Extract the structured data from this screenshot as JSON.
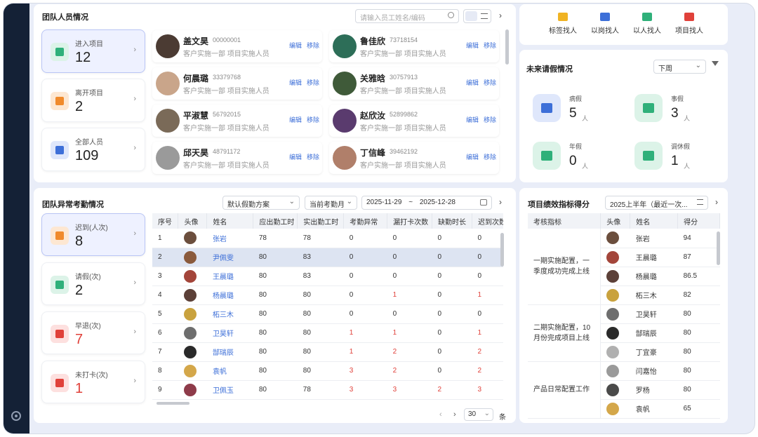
{
  "team": {
    "title": "团队人员情况",
    "search_placeholder": "请输入员工姓名/编码",
    "stats": [
      {
        "label": "进入项目",
        "value": "12",
        "color": "#2fb07a",
        "bg": "#dcf3e8"
      },
      {
        "label": "离开项目",
        "value": "2",
        "color": "#f08a2c",
        "bg": "#fde7d2"
      },
      {
        "label": "全部人员",
        "value": "109",
        "color": "#3d6fd8",
        "bg": "#dfe7fb"
      }
    ],
    "edit_label": "编辑",
    "remove_label": "移除",
    "people": [
      {
        "name": "盖文昊",
        "id": "00000001",
        "dept": "客户实施一部  项目实施人员",
        "avatar": "#4b3b33"
      },
      {
        "name": "鲁佳欣",
        "id": "73718154",
        "dept": "客户实施一部  项目实施人员",
        "avatar": "#2d6e58"
      },
      {
        "name": "何晨璐",
        "id": "33379768",
        "dept": "客户实施一部  项目实施人员",
        "avatar": "#c9a58a"
      },
      {
        "name": "关雅晗",
        "id": "30757913",
        "dept": "客户实施一部  项目实施人员",
        "avatar": "#3f5a39"
      },
      {
        "name": "平淑慧",
        "id": "56792015",
        "dept": "客户实施一部  项目实施人员",
        "avatar": "#7a6a58"
      },
      {
        "name": "赵欣汝",
        "id": "52899862",
        "dept": "客户实施一部  项目实施人员",
        "avatar": "#5a3b6e"
      },
      {
        "name": "邱天昊",
        "id": "48791172",
        "dept": "客户实施一部  项目实施人员",
        "avatar": "#9a9a9a"
      },
      {
        "name": "丁信峰",
        "id": "39462192",
        "dept": "客户实施一部  项目实施人员",
        "avatar": "#b07f6a"
      }
    ]
  },
  "finder": {
    "items": [
      {
        "label": "标签找人",
        "color": "#f0b323"
      },
      {
        "label": "以岗找人",
        "color": "#3d6fd8"
      },
      {
        "label": "以人找人",
        "color": "#2fb07a"
      },
      {
        "label": "项目找人",
        "color": "#e0413a"
      }
    ]
  },
  "leave": {
    "title": "未来请假情况",
    "period": "下周",
    "unit": "人",
    "items": [
      {
        "label": "病假",
        "value": "5",
        "color": "#3d6fd8",
        "bg": "#dfe7fb"
      },
      {
        "label": "事假",
        "value": "3",
        "color": "#2fb07a",
        "bg": "#dcf3e8"
      },
      {
        "label": "年假",
        "value": "0",
        "color": "#2fb07a",
        "bg": "#dcf3e8"
      },
      {
        "label": "调休假",
        "value": "1",
        "color": "#2fb07a",
        "bg": "#dcf3e8"
      }
    ]
  },
  "attendance": {
    "title": "团队异常考勤情况",
    "scheme": "默认假勤方案",
    "month": "当前考勤月",
    "date_from": "2025-11-29",
    "date_sep": "~",
    "date_to": "2025-12-28",
    "stats": [
      {
        "label": "迟到(人次)",
        "value": "8",
        "color": "#f08a2c",
        "bg": "#fde7d2",
        "red": false
      },
      {
        "label": "请假(次)",
        "value": "2",
        "color": "#2fb07a",
        "bg": "#dcf3e8",
        "red": false
      },
      {
        "label": "早退(次)",
        "value": "7",
        "color": "#e0413a",
        "bg": "#fde0df",
        "red": true
      },
      {
        "label": "未打卡(次)",
        "value": "1",
        "color": "#e0413a",
        "bg": "#fde0df",
        "red": true
      }
    ],
    "columns": [
      "序号",
      "头像",
      "姓名",
      "应出勤工时",
      "实出勤工时",
      "考勤异常",
      "漏打卡次数",
      "缺勤时长",
      "迟到次数"
    ],
    "rows": [
      {
        "no": "1",
        "name": "张岩",
        "plan": "78",
        "actual": "78",
        "abn": "0",
        "miss": "0",
        "absent": "0",
        "late": "0",
        "avatar": "#6b4e3d"
      },
      {
        "no": "2",
        "name": "尹佩雯",
        "plan": "80",
        "actual": "83",
        "abn": "0",
        "miss": "0",
        "absent": "0",
        "late": "0",
        "avatar": "#8a5a3c"
      },
      {
        "no": "3",
        "name": "王晨璐",
        "plan": "80",
        "actual": "83",
        "abn": "0",
        "miss": "0",
        "absent": "0",
        "late": "0",
        "avatar": "#a3453a"
      },
      {
        "no": "4",
        "name": "杨晨璐",
        "plan": "80",
        "actual": "80",
        "abn": "0",
        "miss": "1",
        "absent": "0",
        "late": "1",
        "avatar": "#5c4038"
      },
      {
        "no": "5",
        "name": "柘三木",
        "plan": "80",
        "actual": "80",
        "abn": "0",
        "miss": "0",
        "absent": "0",
        "late": "0",
        "avatar": "#c9a23e"
      },
      {
        "no": "6",
        "name": "卫昊轩",
        "plan": "80",
        "actual": "80",
        "abn": "1",
        "miss": "1",
        "absent": "0",
        "late": "1",
        "avatar": "#6e6e6e"
      },
      {
        "no": "7",
        "name": "郜瑞辰",
        "plan": "80",
        "actual": "80",
        "abn": "1",
        "miss": "2",
        "absent": "0",
        "late": "2",
        "avatar": "#2a2a2a"
      },
      {
        "no": "8",
        "name": "袁帆",
        "plan": "80",
        "actual": "80",
        "abn": "3",
        "miss": "2",
        "absent": "0",
        "late": "2",
        "avatar": "#d4a74a"
      },
      {
        "no": "9",
        "name": "卫佩玉",
        "plan": "80",
        "actual": "78",
        "abn": "3",
        "miss": "3",
        "absent": "2",
        "late": "3",
        "avatar": "#8e3b4a"
      }
    ],
    "page_size": "30",
    "page_unit": "条"
  },
  "performance": {
    "title": "项目绩效指标得分",
    "period": "2025上半年（最近一次...",
    "columns": [
      "考核指标",
      "头像",
      "姓名",
      "得分"
    ],
    "groups": [
      {
        "indicator": "一期实施配置，一季度成功完成上线",
        "rows": [
          {
            "name": "张岩",
            "score": "94",
            "avatar": "#6b4e3d"
          },
          {
            "name": "王晨璐",
            "score": "87",
            "avatar": "#a3453a"
          },
          {
            "name": "杨晨璐",
            "score": "86.5",
            "avatar": "#5c4038"
          },
          {
            "name": "柘三木",
            "score": "82",
            "avatar": "#c9a23e"
          }
        ]
      },
      {
        "indicator": "二期实施配置，10月份完成项目上线",
        "rows": [
          {
            "name": "卫昊轩",
            "score": "80",
            "avatar": "#6e6e6e"
          },
          {
            "name": "郜瑞辰",
            "score": "80",
            "avatar": "#2a2a2a"
          },
          {
            "name": "丁宜豪",
            "score": "80",
            "avatar": "#b0b0b0"
          }
        ]
      },
      {
        "indicator": "产品日常配置工作",
        "rows": [
          {
            "name": "闫嘉怡",
            "score": "80",
            "avatar": "#9a9a9a"
          },
          {
            "name": "罗杨",
            "score": "80",
            "avatar": "#4a4a4a"
          },
          {
            "name": "袁帆",
            "score": "65",
            "avatar": "#d4a74a"
          }
        ]
      }
    ]
  }
}
